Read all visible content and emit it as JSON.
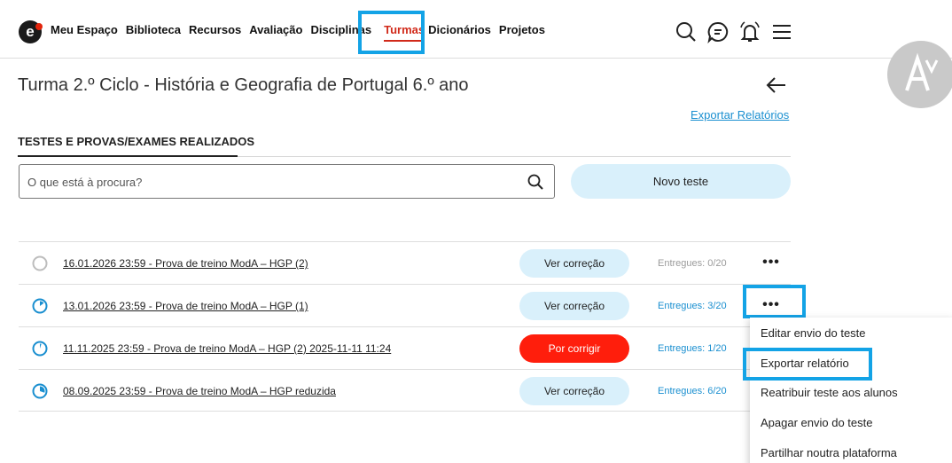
{
  "nav": {
    "logo": "e",
    "items": [
      "Meu Espaço",
      "Biblioteca",
      "Recursos",
      "Avaliação",
      "Disciplinas",
      "Turmas",
      "Dicionários",
      "Projetos"
    ],
    "active": "Turmas",
    "icons": [
      "search-icon",
      "chat-icon",
      "bell-icon",
      "menu-icon"
    ],
    "accent": "#d12a1a"
  },
  "header": {
    "title": "Turma 2.º Ciclo - História e Geografia de Portugal 6.º ano",
    "export_link": "Exportar Relatórios"
  },
  "section": {
    "title": "TESTES E PROVAS/EXAMES REALIZADOS"
  },
  "search": {
    "placeholder": "O que está à procura?",
    "value": ""
  },
  "new_test_label": "Novo teste",
  "tests": [
    {
      "title": "16.01.2026 23:59 - Prova de treino ModA – HGP (2)",
      "action": "Ver correção",
      "delivered": "Entregues: 0/20",
      "progress": 0
    },
    {
      "title": "13.01.2026 23:59 - Prova de treino ModA – HGP (1)",
      "action": "Ver correção",
      "delivered": "Entregues: 3/20",
      "progress": 0.15
    },
    {
      "title": "11.11.2025 23:59 - Prova de treino ModA – HGP (2) 2025-11-11 11:24",
      "action": "Por corrigir",
      "delivered": "Entregues: 1/20",
      "progress": 0.05
    },
    {
      "title": "08.09.2025 23:59 - Prova de treino ModA – HGP reduzida",
      "action": "Ver correção",
      "delivered": "Entregues: 6/20",
      "progress": 0.3
    }
  ],
  "more_label": "•••",
  "menu": {
    "items": [
      "Editar envio do teste",
      "Exportar relatório",
      "Reatribuir teste aos alunos",
      "Apagar envio do teste",
      "Partilhar noutra plataforma"
    ]
  },
  "colors": {
    "primary_blue": "#1a8fd0",
    "button_light": "#d9f0fb",
    "danger": "#ff1e0c",
    "highlight": "#13a3e6"
  }
}
